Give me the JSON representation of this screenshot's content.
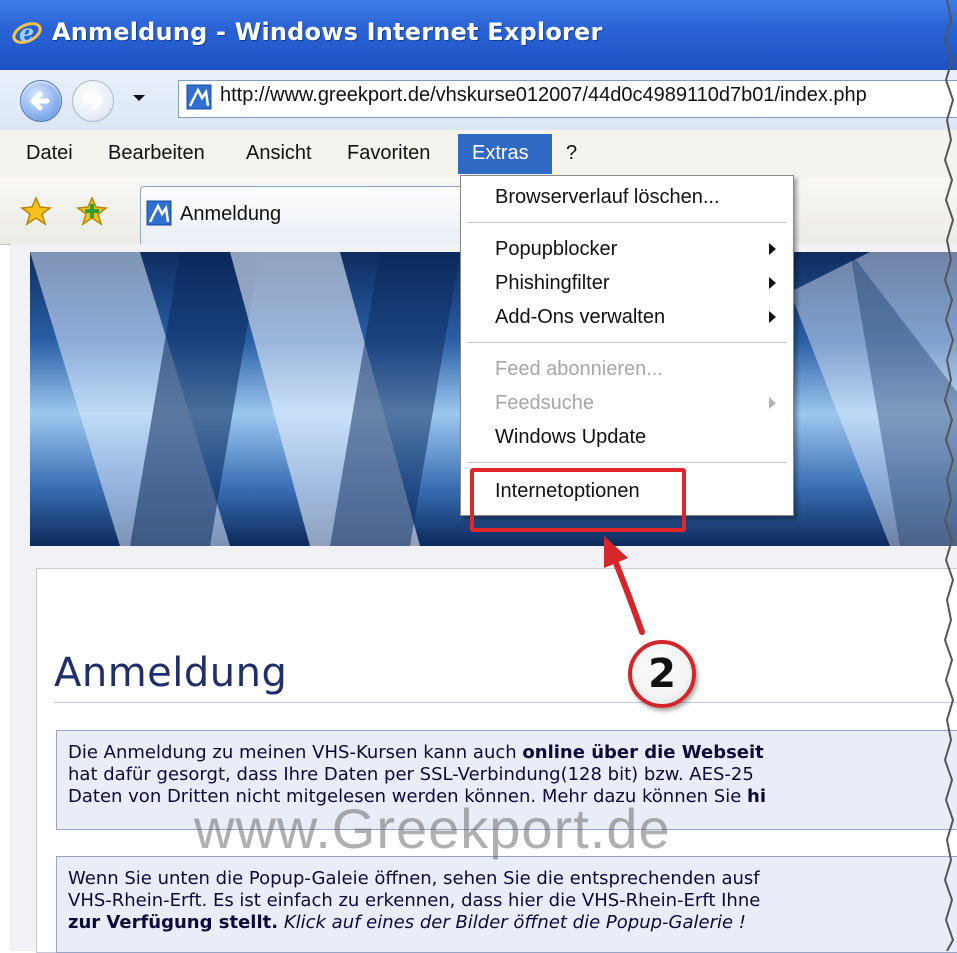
{
  "window": {
    "title": "Anmeldung - Windows Internet Explorer"
  },
  "address_bar": {
    "url": "http://www.greekport.de/vhskurse012007/44d0c4989110d7b01/index.php"
  },
  "menu": {
    "items": [
      "Datei",
      "Bearbeiten",
      "Ansicht",
      "Favoriten",
      "Extras",
      "?"
    ],
    "active": "Extras"
  },
  "tab": {
    "label": "Anmeldung"
  },
  "extras_menu": {
    "items": [
      {
        "label": "Browserverlauf löschen...",
        "enabled": true,
        "submenu": false
      },
      {
        "label": "Popupblocker",
        "enabled": true,
        "submenu": true
      },
      {
        "label": "Phishingfilter",
        "enabled": true,
        "submenu": true
      },
      {
        "label": "Add-Ons verwalten",
        "enabled": true,
        "submenu": true
      },
      {
        "label": "Feed abonnieren...",
        "enabled": false,
        "submenu": false
      },
      {
        "label": "Feedsuche",
        "enabled": false,
        "submenu": true
      },
      {
        "label": "Windows Update",
        "enabled": true,
        "submenu": false
      },
      {
        "label": "Internetoptionen",
        "enabled": true,
        "submenu": false
      }
    ]
  },
  "annotation": {
    "step_number": "2",
    "highlight_color": "#e1262b"
  },
  "page": {
    "heading": "Anmeldung",
    "box1": {
      "line1_pre": "Die Anmeldung zu meinen VHS-Kursen kann auch ",
      "line1_bold": "online über die Webseit",
      "line2": "hat dafür gesorgt, dass Ihre Daten per SSL-Verbindung(128 bit) bzw. AES-25",
      "line3_pre": "Daten von Dritten nicht mitgelesen werden können. Mehr dazu können Sie ",
      "line3_bold": "hi"
    },
    "box2": {
      "line1": "Wenn Sie unten die Popup-Galeie öffnen, sehen Sie die entsprechenden ausf",
      "line2": "VHS-Rhein-Erft. Es ist einfach zu erkennen, dass hier die VHS-Rhein-Erft Ihne",
      "line3_bold": "zur Verfügung stellt.",
      "line3_italic": " Klick auf eines der Bilder öffnet die Popup-Galerie !"
    }
  },
  "watermark": "www.Greekport.de",
  "icons": [
    "ie-logo-icon",
    "back-arrow-icon",
    "forward-arrow-icon",
    "page-icon",
    "favorites-star-icon",
    "add-favorite-icon",
    "submenu-arrow-icon"
  ],
  "colors": {
    "titlebar": "#2a63d6",
    "menu_highlight": "#316ac5",
    "heading": "#1f2f6c"
  }
}
